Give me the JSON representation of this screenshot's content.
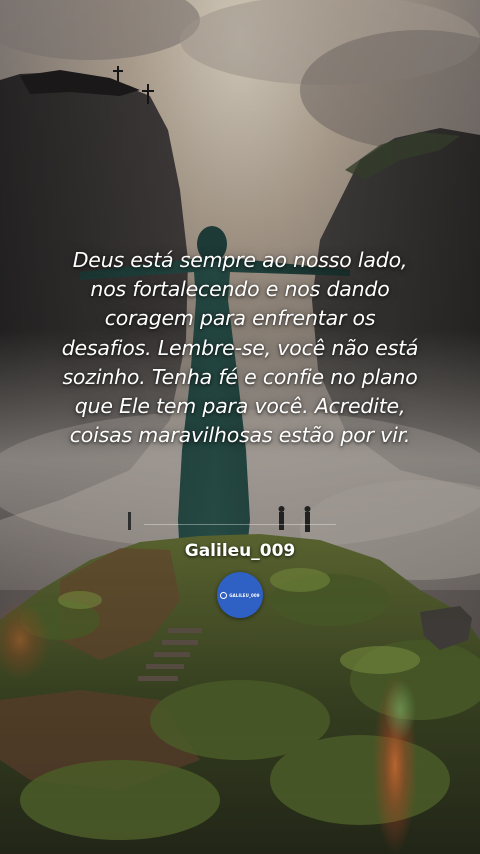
{
  "quote": {
    "line1": "Deus está sempre ao nosso lado,",
    "line2": "nos fortalecendo e nos dando",
    "line3": "coragem para enfrentar os",
    "line4": "desafios. Lembre-se, você não está",
    "line5": "sozinho. Tenha fé e confie no plano",
    "line6": "que Ele tem para você. Acredite,",
    "line7": "coisas maravilhosas estão por vir."
  },
  "author": {
    "name": "Galileu_009",
    "badge_text": "GALILEU_009",
    "badge_color": "#2f60c4"
  }
}
